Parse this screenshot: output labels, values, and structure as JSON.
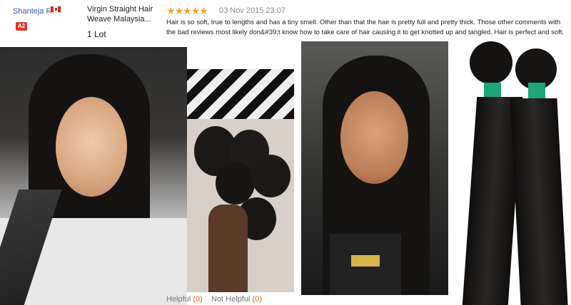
{
  "reviewer": {
    "name": "Shanteja R.",
    "level": "A2",
    "country_flag": "canada-flag-icon"
  },
  "product": {
    "title": "Virgin Straight Hair Weave Malaysia...",
    "quantity": "1 Lot"
  },
  "review": {
    "rating": 5,
    "date": "03 Nov 2015 23:07",
    "text": "Hair is so soft, true to lengths and has a tiny smell. Other than that the hair is pretty full and pretty thick. Those other comments with the bad reviews most likely don&#39;t know how to take care of hair causing it to get knotted up and tangled. Hair is perfect and soft."
  },
  "photos": [
    "photo-1",
    "photo-2",
    "photo-3",
    "photo-4"
  ],
  "feedback": {
    "helpful_label": "Helpful",
    "helpful_count": "(0)",
    "not_helpful_label": "Not Helpful",
    "not_helpful_count": "(0)"
  },
  "colors": {
    "link": "#2a5db0",
    "star": "#f5a623",
    "badge": "#d8382b",
    "count": "#e36a18"
  }
}
